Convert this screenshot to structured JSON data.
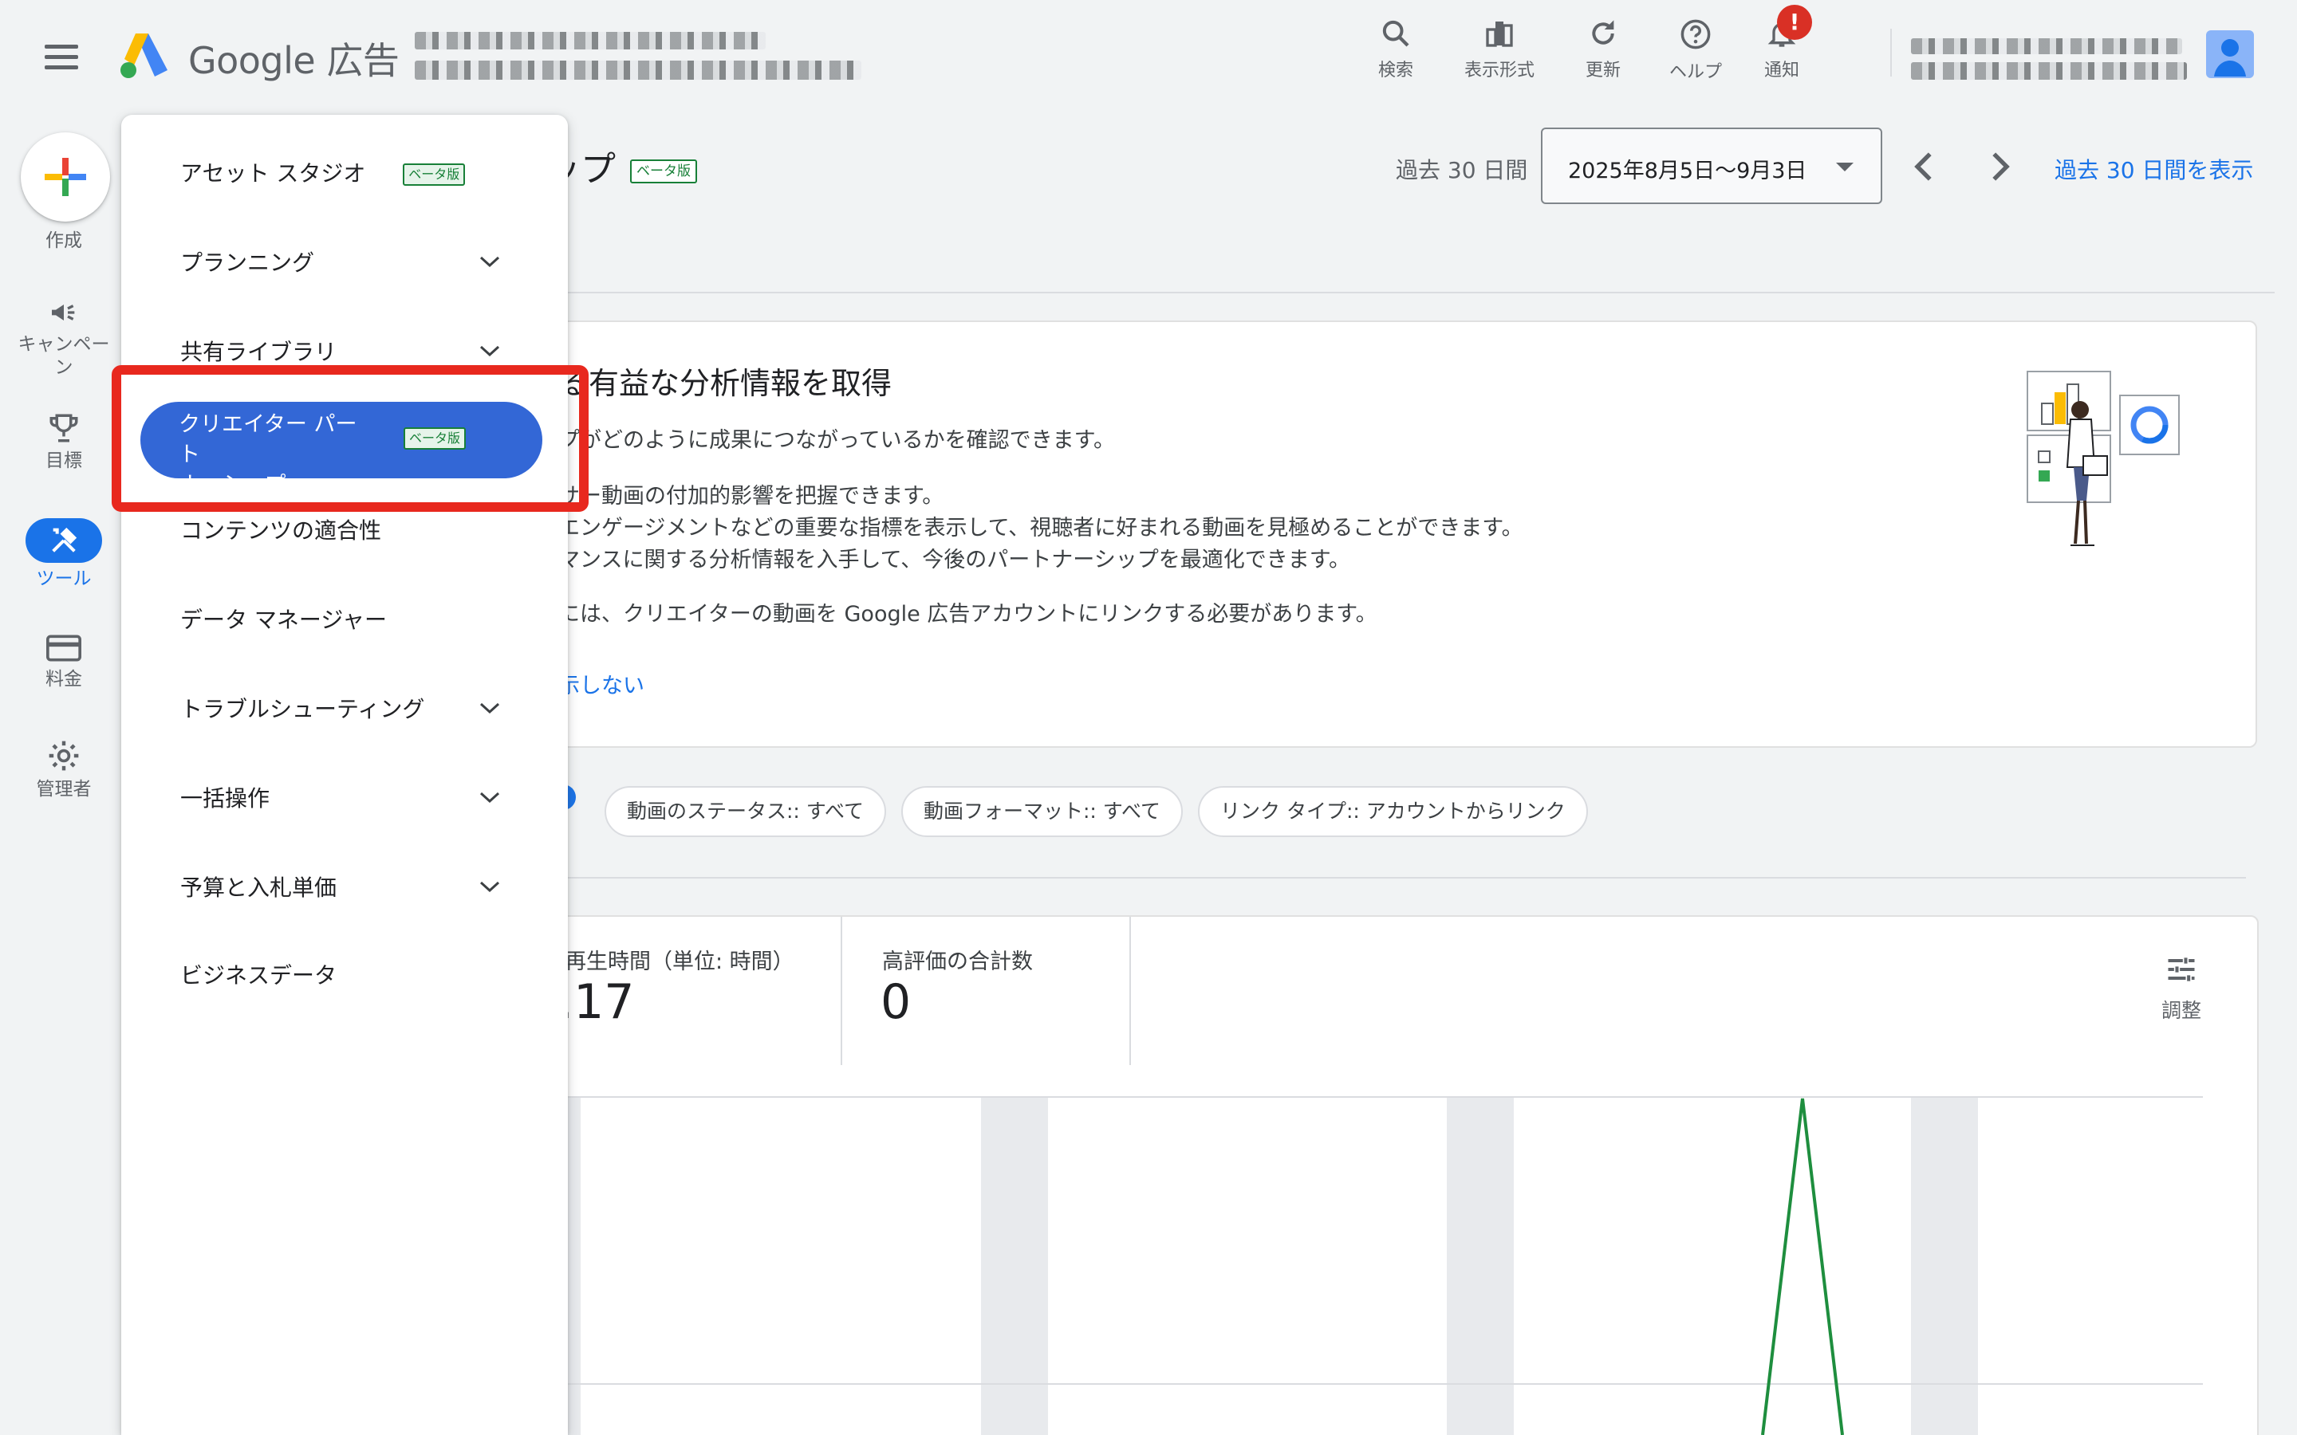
{
  "header": {
    "brand_name": "Google",
    "brand_suffix": "広告",
    "toolbar": [
      {
        "icon": "search-icon",
        "label": "検索"
      },
      {
        "icon": "appearance-icon",
        "label": "表示形式"
      },
      {
        "icon": "refresh-icon",
        "label": "更新"
      },
      {
        "icon": "help-icon",
        "label": "ヘルプ"
      },
      {
        "icon": "bell-icon",
        "label": "通知"
      }
    ],
    "notification_badge": "!"
  },
  "rail": {
    "create_label": "作成",
    "items": [
      {
        "icon": "megaphone-icon",
        "label": "キャンペーン"
      },
      {
        "icon": "trophy-icon",
        "label": "目標"
      },
      {
        "icon": "tools-icon",
        "label": "ツール",
        "active": true
      },
      {
        "icon": "credit-card-icon",
        "label": "料金"
      },
      {
        "icon": "gear-icon",
        "label": "管理者"
      }
    ]
  },
  "menu": {
    "items": [
      {
        "label": "アセット スタジオ",
        "beta": "ベータ版"
      },
      {
        "label": "プランニング",
        "expandable": true
      },
      {
        "label": "共有ライブラリ",
        "expandable": true
      },
      {
        "label": "クリエイター パートナーシップ",
        "beta": "ベータ版",
        "selected": true
      },
      {
        "label": "コンテンツの適合性"
      },
      {
        "label": "データ マネージャー"
      },
      {
        "label": "トラブルシューティング",
        "expandable": true
      },
      {
        "label": "一括操作",
        "expandable": true
      },
      {
        "label": "予算と入札単価",
        "expandable": true
      },
      {
        "label": "ビジネスデータ"
      }
    ],
    "selected_line1": "クリエイター パート",
    "selected_line2": "ナーシップ"
  },
  "page": {
    "title_visible": "シップ",
    "title_beta": "ベータ版",
    "date_range_label": "過去 30 日間",
    "date_range_value": "2025年8月5日〜9月3日",
    "show_link": "過去 30 日間を表示",
    "insight": {
      "title_visible": "る有益な分析情報を取得",
      "line1": "プがどのように成果につながっているかを確認できます。",
      "bullet1": "サー動画の付加的影響を把握できます。",
      "bullet2": "エンゲージメントなどの重要な指標を表示して、視聴者に好まれる動画を見極めることができます。",
      "bullet3": "マンスに関する分析情報を入手して、今後のパートナーシップを最適化できます。",
      "line2": "には、クリエイターの動画を Google 広告アカウントにリンクする必要があります。",
      "dismiss_visible": "示しない"
    },
    "filters": [
      "動画のステータス:: すべて",
      "動画フォーマット:: すべて",
      "リンク タイプ:: アカウントからリンク"
    ],
    "metrics": [
      {
        "label": "再生時間（単位: 時間）",
        "value": ".17"
      },
      {
        "label": "高評価の合計数",
        "value": "0"
      }
    ],
    "adjust_label": "調整"
  },
  "colors": {
    "accent": "#1a73e8",
    "selected_menu": "#3367d6",
    "highlight_box": "#e8281e",
    "beta_green": "#188038",
    "chart_line": "#1e8e3e"
  }
}
